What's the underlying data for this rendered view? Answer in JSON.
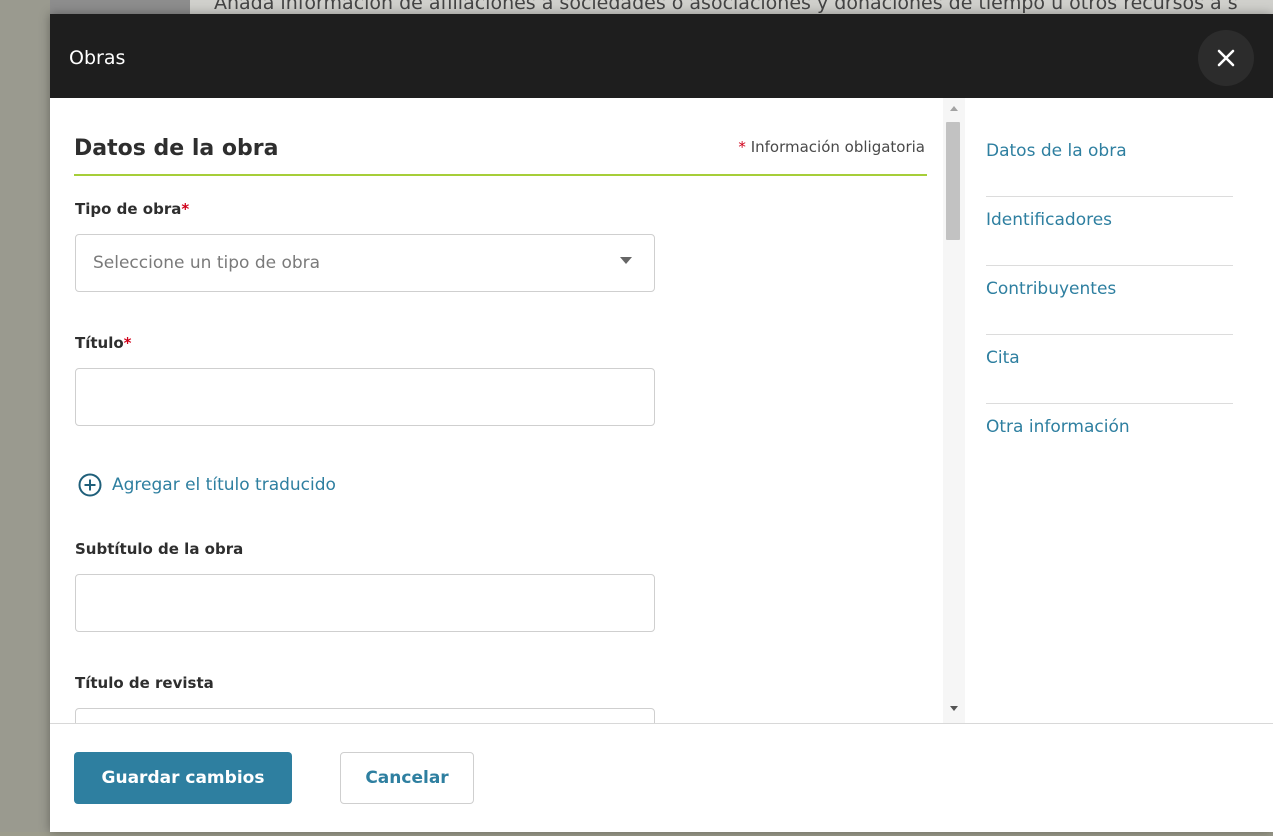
{
  "background": {
    "top_text": "Añada información de afiliaciones a sociedades o asociaciones y donaciones de tiempo u otros recursos a s"
  },
  "modal": {
    "title": "Obras",
    "close_icon": "close-icon"
  },
  "form": {
    "section_title": "Datos de la obra",
    "required_marker": "*",
    "required_note": "Información obligatoria",
    "fields": {
      "work_type": {
        "label": "Tipo de obra",
        "required_marker": "*",
        "placeholder": "Seleccione un tipo de obra"
      },
      "title": {
        "label": "Título",
        "required_marker": "*",
        "value": ""
      },
      "add_translated_title": "Agregar el título traducido",
      "subtitle": {
        "label": "Subtítulo de la obra",
        "value": ""
      },
      "journal_title": {
        "label": "Título de revista",
        "value": ""
      }
    }
  },
  "side_nav": {
    "items": [
      {
        "label": "Datos de la obra"
      },
      {
        "label": "Identificadores"
      },
      {
        "label": "Contribuyentes"
      },
      {
        "label": "Cita"
      },
      {
        "label": "Otra información"
      }
    ]
  },
  "footer": {
    "save_label": "Guardar cambios",
    "cancel_label": "Cancelar"
  },
  "colors": {
    "accent": "#2e7fa0",
    "section_underline": "#a6ce39",
    "required": "#d0021b",
    "header_bg": "#1e1e1e"
  }
}
